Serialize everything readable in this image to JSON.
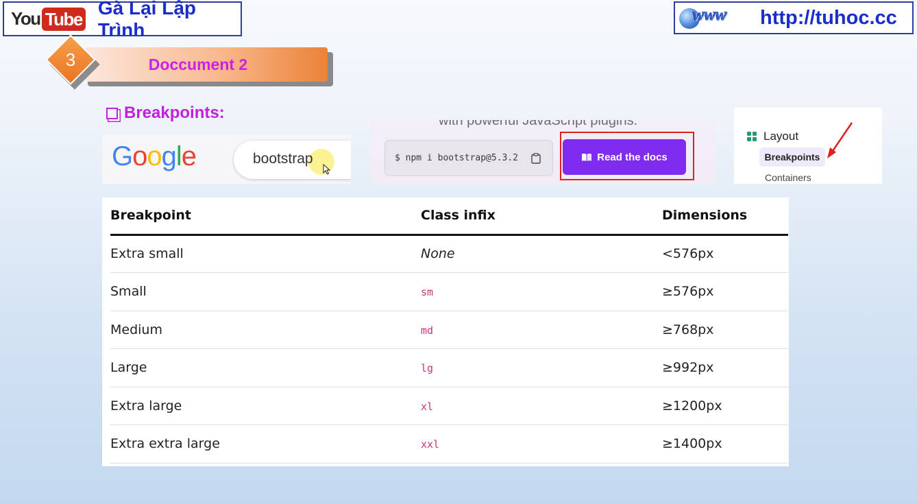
{
  "header": {
    "youtube_you": "You",
    "youtube_tube": "Tube",
    "channel_name": "Gà Lại Lập Trình",
    "www_art": "www",
    "site_url": "http://tuhoc.cc"
  },
  "section": {
    "number": "3",
    "title": "Doccument 2"
  },
  "breakpoints_heading": "Breakpoints:",
  "google_panel": {
    "logo_letters": [
      "G",
      "o",
      "o",
      "g",
      "l",
      "e"
    ],
    "search_query": "bootstrap"
  },
  "bootstrap_panel": {
    "tagline": "with powerful JavaScript plugins.",
    "npm_command": "$ npm i bootstrap@5.3.2",
    "read_docs_label": "Read the docs",
    "button_color": "#7f2cf0",
    "highlight_color": "#e0201a"
  },
  "sidebar_panel": {
    "group_label": "Layout",
    "active_item": "Breakpoints",
    "next_item": "Containers",
    "icon": "grid-icon"
  },
  "table": {
    "headers": [
      "Breakpoint",
      "Class infix",
      "Dimensions"
    ],
    "rows": [
      {
        "breakpoint": "Extra small",
        "infix": "None",
        "dimensions": "<576px"
      },
      {
        "breakpoint": "Small",
        "infix": "sm",
        "dimensions": "≥576px"
      },
      {
        "breakpoint": "Medium",
        "infix": "md",
        "dimensions": "≥768px"
      },
      {
        "breakpoint": "Large",
        "infix": "lg",
        "dimensions": "≥992px"
      },
      {
        "breakpoint": "Extra large",
        "infix": "xl",
        "dimensions": "≥1200px"
      },
      {
        "breakpoint": "Extra extra large",
        "infix": "xxl",
        "dimensions": "≥1400px"
      }
    ]
  },
  "colors": {
    "brand_blue": "#1b2ec9",
    "heading_magenta": "#c01fdc",
    "infix_pink": "#c7347a",
    "banner_orange": "#ec8237"
  }
}
